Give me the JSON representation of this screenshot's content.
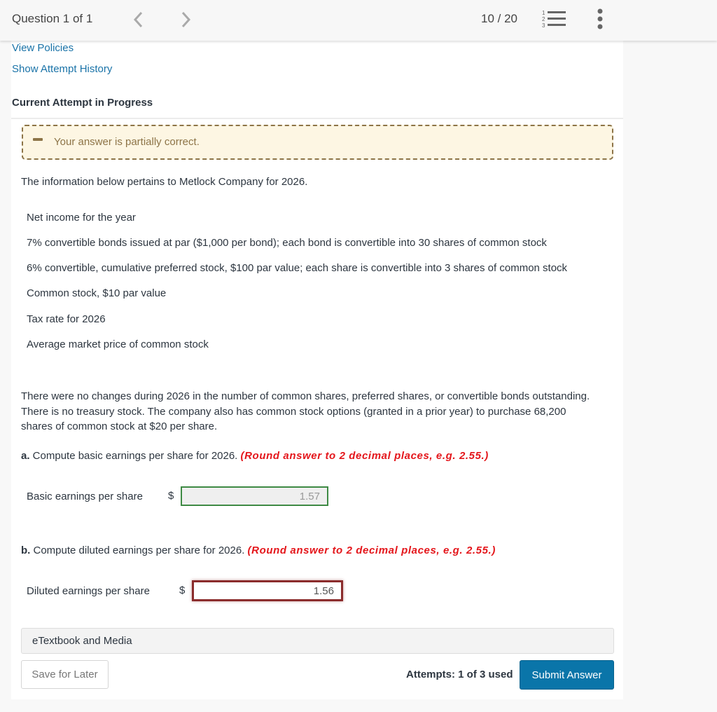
{
  "header": {
    "question_label": "Question 1 of 1",
    "progress": "10 / 20",
    "icons": {
      "prev": "chevron-left-icon",
      "next": "chevron-right-icon",
      "list": "numbered-list-icon",
      "more": "more-vertical-icon"
    }
  },
  "links": {
    "view_policies": "View Policies",
    "attempt_history": "Show Attempt History"
  },
  "attempt_heading": "Current Attempt in Progress",
  "feedback": {
    "text": "Your answer is partially correct.",
    "status": "partial",
    "color": "#8d7447",
    "background": "#fdf6e3"
  },
  "question": {
    "intro": "The information below pertains to Metlock Company for 2026.",
    "facts": [
      "Net income for the year",
      "7% convertible bonds issued at par ($1,000 per bond); each bond is convertible into 30 shares of common stock",
      "6% convertible, cumulative preferred stock, $100 par value; each share is convertible into 3 shares of common stock",
      "Common stock, $10 par value",
      "Tax rate for 2026",
      "Average market price of common stock"
    ],
    "paragraph": "There were no changes during 2026 in the number of common shares, preferred shares, or convertible bonds outstanding. There is no treasury stock. The company also has common stock options (granted in a prior year) to purchase 68,200 shares of common stock at $20 per share.",
    "parts": [
      {
        "letter": "a.",
        "prompt": " Compute basic earnings per share for 2026. ",
        "hint": "(Round answer to 2 decimal places, e.g. 2.55.)",
        "answer_label": "Basic earnings per share",
        "currency": "$",
        "value": "1.57",
        "state": "correct",
        "border_color": "#3e8a44"
      },
      {
        "letter": "b.",
        "prompt": " Compute diluted earnings per share for 2026. ",
        "hint": "(Round answer to 2 decimal places, e.g. 2.55.)",
        "answer_label": "Diluted earnings per share",
        "currency": "$",
        "value": "1.56",
        "state": "incorrect",
        "border_color": "#8b2c2c"
      }
    ]
  },
  "footer": {
    "etextbook": "eTextbook and Media",
    "save_label": "Save for Later",
    "attempts": "Attempts: 1 of 3 used",
    "submit_label": "Submit Answer",
    "submit_color": "#0a75a9"
  }
}
